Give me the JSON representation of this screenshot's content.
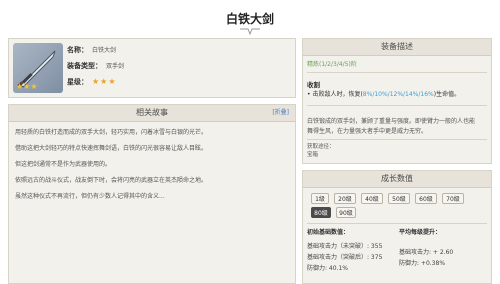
{
  "page": {
    "title": "白铁大剑"
  },
  "weapon": {
    "name_label": "名称：",
    "name_value": "白铁大剑",
    "type_label": "装备类型：",
    "type_value": "双手剑",
    "rarity_label": "星级：",
    "rarity_stars": "★★★",
    "image_stars": "★★★"
  },
  "lore": {
    "header": "相关故事",
    "fold": "[折叠]",
    "lines": [
      "用轻质的白铁打造而成的双手大剑，轻巧实用，闪着冰雪与白银的光芒。",
      "借助这把大剑轻巧的特点快速挥舞剑语，白铁的闪光很容易让敌人目眩。",
      "但这把剑通常不是作为武器使用的。",
      "依照远古的战斗仪式，战友倒下时，会将闪亮的武器立在英杰陨命之地。",
      "虽然这种仪式不再流行，但仍有少数人记得其中的含义..."
    ]
  },
  "description": {
    "header": "装备描述",
    "refine": "精炼(1/2/3/4/5)阶",
    "effect_title": "收割",
    "effect_prefix": "• 击败敌人时，恢复(",
    "effect_values": "8%/10%/12%/14%/16%",
    "effect_suffix": ")生命值。",
    "flavor_line1": "白铁锻成的双手剑，兼顾了重量与强度。即使臂力一般的人也能",
    "flavor_line2": "舞得生风，在力量强大者手中更是威力无穷。",
    "source_label": "获取途径：",
    "source_value": "宝箱"
  },
  "growth": {
    "header": "成长数值",
    "levels": [
      "1级",
      "20级",
      "40级",
      "50级",
      "60级",
      "70级",
      "80级",
      "90级"
    ],
    "active_level": "80级",
    "base_header": "初始基础数值：",
    "avg_header": "平均每级提升：",
    "base_atk": "基础攻击力（未突破）: 355",
    "base_atk2": "基础攻击力（突破后）: 375",
    "base_def": "防御力: 40.1%",
    "avg_atk": "基础攻击力: + 2.60",
    "avg_def": "防御力: +0.38%"
  }
}
